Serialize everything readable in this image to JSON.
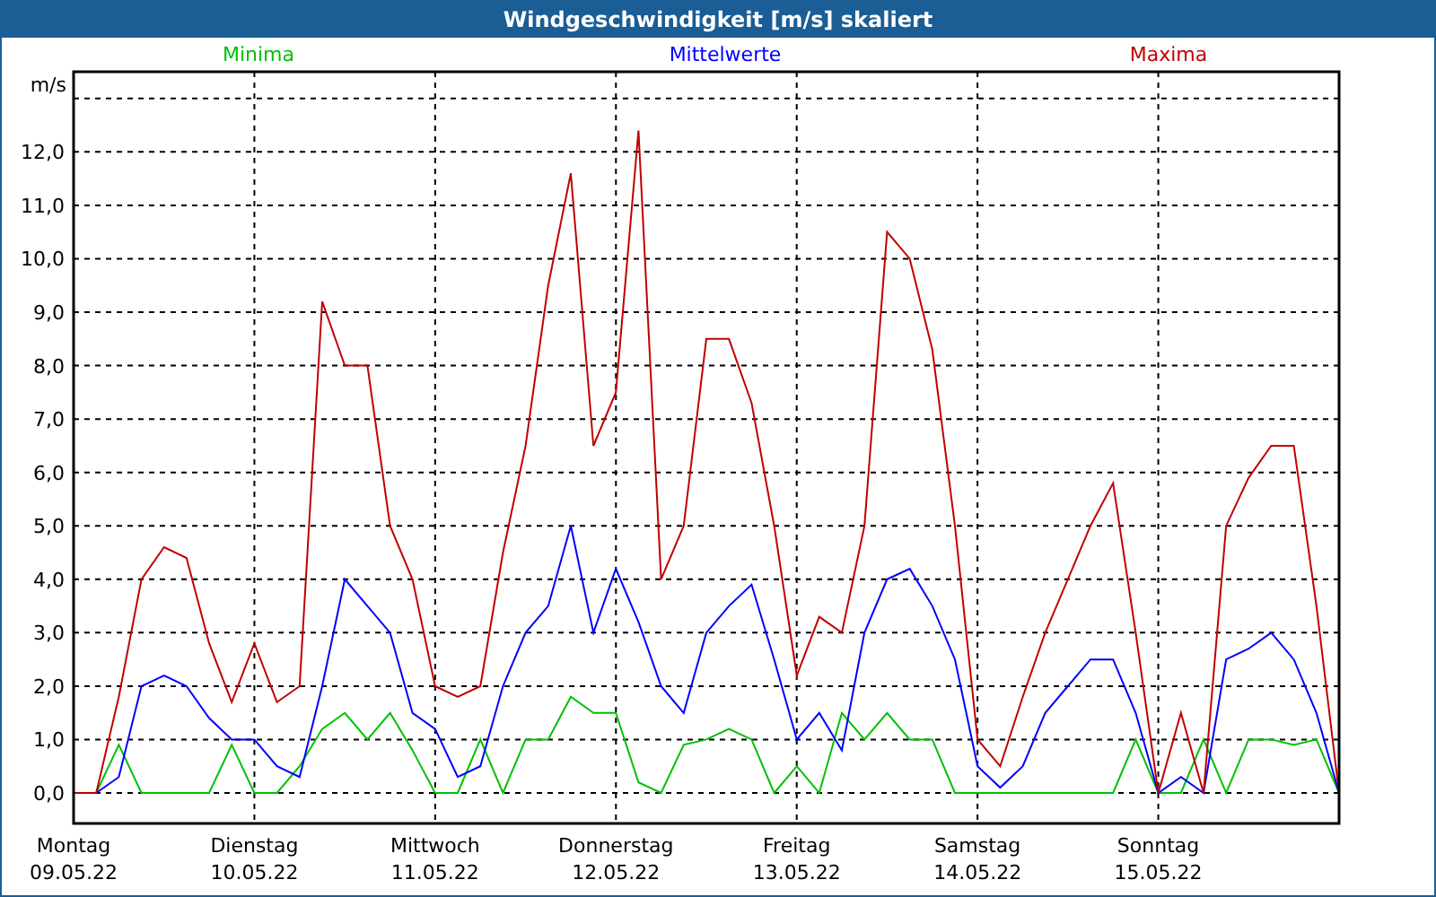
{
  "window": {
    "title": "Windgeschwindigkeit [m/s] skaliert"
  },
  "chart": {
    "chart_data": {
      "type": "line",
      "grid": true,
      "ylabel": "m/s",
      "ylim": [
        -0.57,
        13.5
      ],
      "yticks": [
        {
          "value": 0,
          "label": "0,0"
        },
        {
          "value": 1,
          "label": "1,0"
        },
        {
          "value": 2,
          "label": "2,0"
        },
        {
          "value": 3,
          "label": "3,0"
        },
        {
          "value": 4,
          "label": "4,0"
        },
        {
          "value": 5,
          "label": "5,0"
        },
        {
          "value": 6,
          "label": "6,0"
        },
        {
          "value": 7,
          "label": "7,0"
        },
        {
          "value": 8,
          "label": "8,0"
        },
        {
          "value": 9,
          "label": "9,0"
        },
        {
          "value": 10,
          "label": "10,0"
        },
        {
          "value": 11,
          "label": "11,0"
        },
        {
          "value": 12,
          "label": "12,0"
        }
      ],
      "categories": [
        "Montag\n09.05.22",
        null,
        null,
        null,
        null,
        null,
        null,
        null,
        "Dienstag\n10.05.22",
        null,
        null,
        null,
        null,
        null,
        null,
        null,
        "Mittwoch\n11.05.22",
        null,
        null,
        null,
        null,
        null,
        null,
        null,
        "Donnerstag\n12.05.22",
        null,
        null,
        null,
        null,
        null,
        null,
        null,
        "Freitag\n13.05.22",
        null,
        null,
        null,
        null,
        null,
        null,
        null,
        "Samstag\n14.05.22",
        null,
        null,
        null,
        null,
        null,
        null,
        null,
        "Sonntag\n15.05.22",
        null,
        null,
        null,
        null,
        null,
        null,
        null,
        null
      ],
      "series": [
        {
          "name": "Minima",
          "color": "#00c000",
          "values": [
            0,
            0,
            0.9,
            0,
            0,
            0,
            0,
            0.9,
            0,
            0,
            0.5,
            1.2,
            1.5,
            1,
            1.5,
            0.8,
            0,
            0,
            1,
            0,
            1,
            1,
            1.8,
            1.5,
            1.5,
            0.2,
            0,
            0.9,
            1,
            1.2,
            1,
            0,
            0.5,
            0,
            1.5,
            1,
            1.5,
            1,
            1,
            0,
            0,
            0,
            0,
            0,
            0,
            0,
            0,
            1,
            0,
            0,
            1,
            0,
            1,
            1,
            0.9,
            1,
            0
          ]
        },
        {
          "name": "Mittelwerte",
          "color": "#0000ff",
          "values": [
            0,
            0,
            0.3,
            2,
            2.2,
            2,
            1.4,
            1,
            1,
            0.5,
            0.3,
            2,
            4,
            3.5,
            3,
            1.5,
            1.2,
            0.3,
            0.5,
            2,
            3,
            3.5,
            5,
            3,
            4.2,
            3.2,
            2,
            1.5,
            3,
            3.5,
            3.9,
            2.5,
            1,
            1.5,
            0.8,
            3,
            4,
            4.2,
            3.5,
            2.5,
            0.5,
            0.1,
            0.5,
            1.5,
            2,
            2.5,
            2.5,
            1.5,
            0,
            0.3,
            0,
            2.5,
            2.7,
            3,
            2.5,
            1.5,
            0
          ]
        },
        {
          "name": "Maxima",
          "color": "#c00000",
          "values": [
            0,
            0,
            1.8,
            4,
            4.6,
            4.4,
            2.8,
            1.7,
            2.8,
            1.7,
            2,
            9.2,
            8,
            8,
            5,
            4,
            2,
            1.8,
            2,
            4.5,
            6.5,
            9.5,
            11.6,
            6.5,
            7.5,
            12.4,
            4,
            5,
            8.5,
            8.5,
            7.3,
            5,
            2.2,
            3.3,
            3,
            5,
            10.5,
            10,
            8.3,
            5,
            1,
            0.5,
            1.8,
            3,
            4,
            5,
            5.8,
            3,
            0,
            1.5,
            0,
            5,
            5.9,
            6.5,
            6.5,
            3.5,
            0
          ]
        }
      ]
    }
  }
}
